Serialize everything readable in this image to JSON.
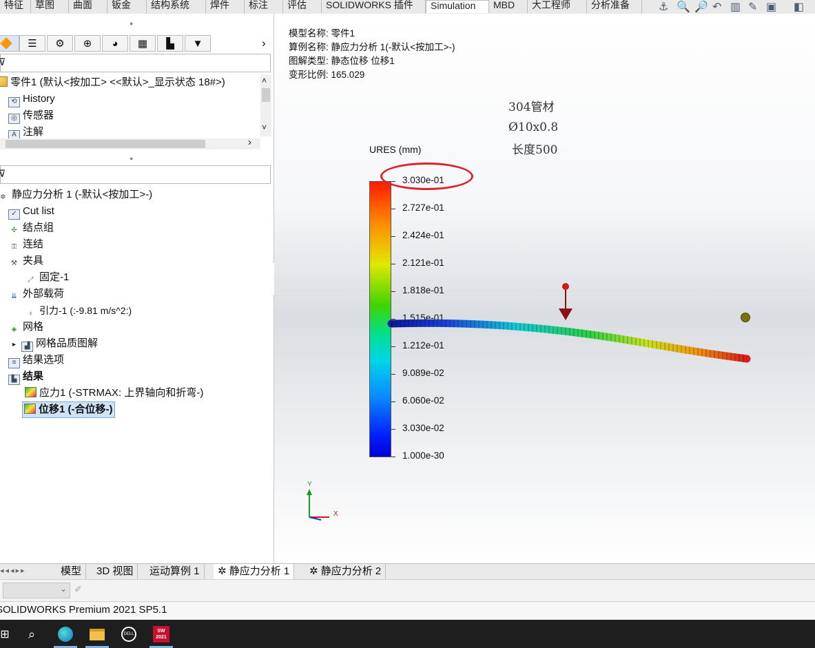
{
  "command_tabs": [
    {
      "label": "特征",
      "active": false
    },
    {
      "label": "草图",
      "active": false
    },
    {
      "label": "曲面",
      "active": false
    },
    {
      "label": "钣金",
      "active": false
    },
    {
      "label": "结构系统",
      "active": false
    },
    {
      "label": "焊件",
      "active": false
    },
    {
      "label": "标注",
      "active": false
    },
    {
      "label": "评估",
      "active": false
    },
    {
      "label": "SOLIDWORKS 插件",
      "active": false
    },
    {
      "label": "Simulation",
      "active": true
    },
    {
      "label": "MBD",
      "active": false
    },
    {
      "label": "大工程师",
      "active": false
    },
    {
      "label": "分析准备",
      "active": false
    }
  ],
  "feature_tree": {
    "part_name": "零件1 (默认<按加工> <<默认>_显示状态 18#>)",
    "items": [
      "History",
      "传感器",
      "注解"
    ]
  },
  "study_tree": {
    "study": "静应力分析 1 (-默认<按加工>-)",
    "items": {
      "cut_list": "Cut list",
      "joint_group": "结点组",
      "connections": "连结",
      "fixtures": "夹具",
      "fixed": "固定-1",
      "external_loads": "外部载荷",
      "gravity": "引力-1 (:-9.81 m/s^2:)",
      "mesh": "网格",
      "mesh_quality": "网格品质图解",
      "result_options": "结果选项",
      "results": "结果",
      "stress": "应力1 (-STRMAX: 上界轴向和折弯-)",
      "displacement": "位移1 (-合位移-)"
    }
  },
  "model_info": {
    "model_name": "模型名称: 零件1",
    "study_name": "算例名称: 静应力分析 1(-默认<按加工>-)",
    "plot_type": "图解类型: 静态位移 位移1",
    "deform_scale": "变形比例: 165.029"
  },
  "annotation": {
    "material": "304管材",
    "size": "Ø10x0.8",
    "length": "长度500"
  },
  "legend": {
    "title": "URES (mm)",
    "labels": [
      "3.030e-01",
      "2.727e-01",
      "2.424e-01",
      "2.121e-01",
      "1.818e-01",
      "1.515e-01",
      "1.212e-01",
      "9.089e-02",
      "6.060e-02",
      "3.030e-02",
      "1.000e-30"
    ]
  },
  "triad": {
    "x": "X",
    "y": "Y"
  },
  "bottom_tabs": [
    {
      "label": "模型",
      "active": false
    },
    {
      "label": "3D 视图",
      "active": false
    },
    {
      "label": "运动算例 1",
      "active": false
    },
    {
      "label": "静应力分析 1",
      "active": true
    },
    {
      "label": "静应力分析 2",
      "active": false
    }
  ],
  "status": "SOLIDWORKS Premium 2021 SP5.1",
  "taskbar": {
    "sw_badge": "SW\n2021",
    "dell": "DELL"
  },
  "colors": {
    "accent_red": "#e0202a",
    "selection": "#cfe3f8"
  }
}
